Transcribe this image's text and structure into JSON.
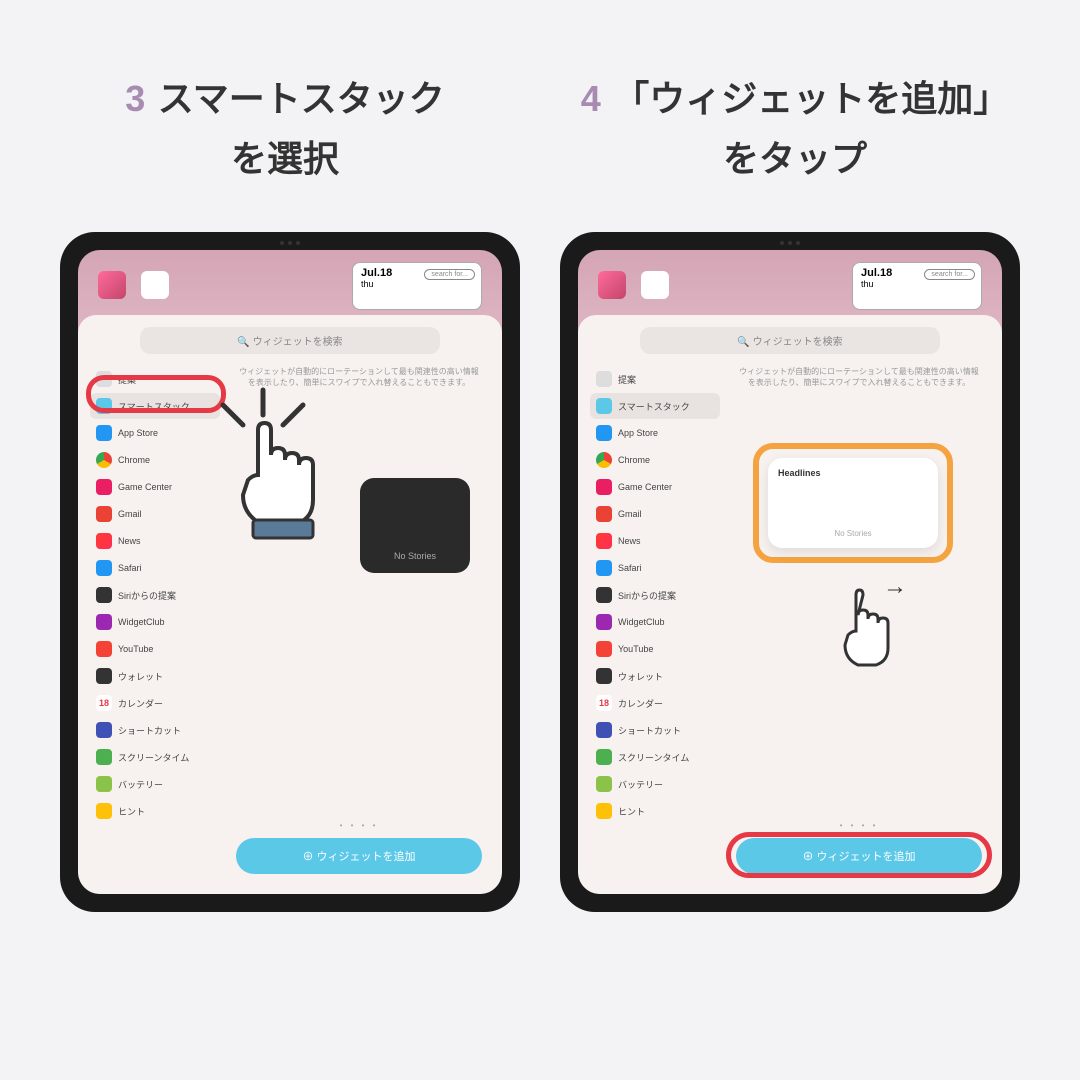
{
  "step3": {
    "number": "3",
    "line1": "スマートスタック",
    "line2": "を選択"
  },
  "step4": {
    "number": "4",
    "line1": "「ウィジェットを追加」",
    "line2": "をタップ"
  },
  "search_placeholder": "ウィジェットを検索",
  "description": "ウィジェットが自動的にローテーションして最も関連性の高い情報を表示したり、簡単にスワイプで入れ替えることもできます。",
  "sidebar_items": [
    {
      "label": "提案",
      "color": "#ddd"
    },
    {
      "label": "スマートスタック",
      "color": "#5bc8e8"
    },
    {
      "label": "App Store",
      "color": "#2196f3"
    },
    {
      "label": "Chrome",
      "color": "#fff"
    },
    {
      "label": "Game Center",
      "color": "#e91e63"
    },
    {
      "label": "Gmail",
      "color": "#ea4335"
    },
    {
      "label": "News",
      "color": "#fff"
    },
    {
      "label": "Safari",
      "color": "#2196f3"
    },
    {
      "label": "Siriからの提案",
      "color": "#333"
    },
    {
      "label": "WidgetClub",
      "color": "#9c27b0"
    },
    {
      "label": "YouTube",
      "color": "#f44336"
    },
    {
      "label": "ウォレット",
      "color": "#333"
    },
    {
      "label": "カレンダー",
      "color": "#fff"
    },
    {
      "label": "ショートカット",
      "color": "#3f51b5"
    },
    {
      "label": "スクリーンタイム",
      "color": "#4caf50"
    },
    {
      "label": "バッテリー",
      "color": "#8bc34a"
    },
    {
      "label": "ヒント",
      "color": "#ffc107"
    }
  ],
  "calendar_text": "18",
  "date_widget": {
    "date": "Jul.18",
    "day": "thu",
    "search": "search for..."
  },
  "widget_preview": {
    "headlines": "Headlines",
    "no_stories": "No Stories"
  },
  "add_widget_button": "ウィジェットを追加",
  "page_dots": "• • • •"
}
